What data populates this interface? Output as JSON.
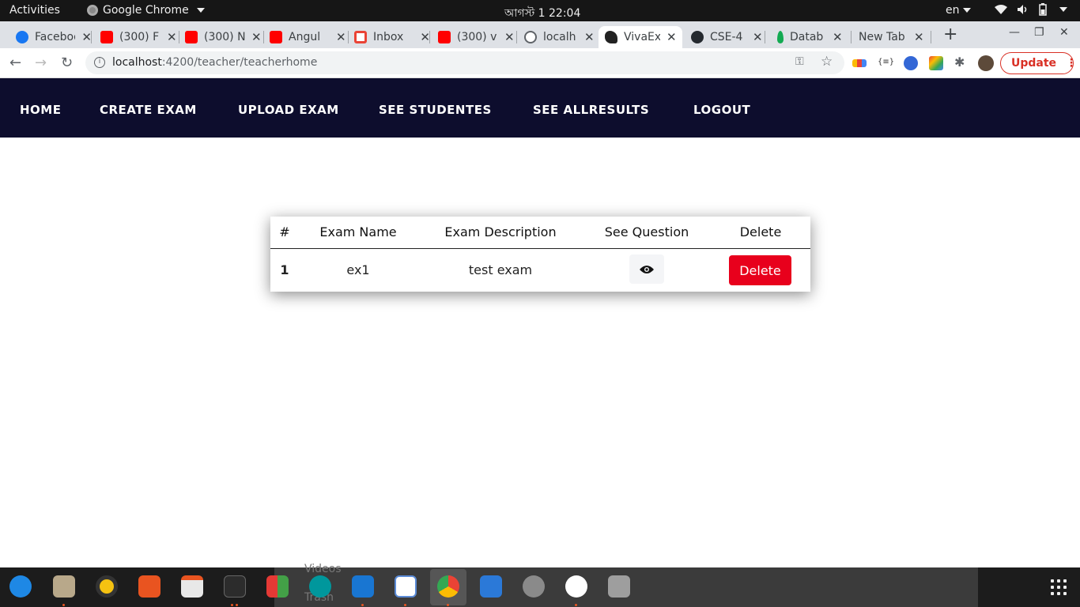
{
  "system_bar": {
    "activities": "Activities",
    "app_name": "Google Chrome",
    "clock": "আগস্ট 1  22:04",
    "language": "en"
  },
  "browser": {
    "tabs": [
      {
        "title": "Facebook",
        "icon": "facebook-icon"
      },
      {
        "title": "(300) F",
        "icon": "youtube-icon"
      },
      {
        "title": "(300) N",
        "icon": "youtube-icon"
      },
      {
        "title": "Angul",
        "icon": "youtube-icon"
      },
      {
        "title": "Inbox",
        "icon": "gmail-icon"
      },
      {
        "title": "(300) v",
        "icon": "youtube-icon"
      },
      {
        "title": "localh",
        "icon": "globe-icon"
      },
      {
        "title": "VivaEx",
        "icon": "vivaexam-icon",
        "active": true
      },
      {
        "title": "CSE-4",
        "icon": "github-icon"
      },
      {
        "title": "Datab",
        "icon": "mongodb-icon"
      },
      {
        "title": "New Tab",
        "icon": ""
      }
    ],
    "url_host": "localhost",
    "url_path": ":4200/teacher/teacherhome",
    "update_label": "Update"
  },
  "navbar": {
    "home": "HOME",
    "create_exam": "CREATE EXAM",
    "upload_exam": "UPLOAD EXAM",
    "see_students": "SEE STUDENTES",
    "see_allresults": "SEE ALLRESULTS",
    "logout": "LOGOUT"
  },
  "exam_table": {
    "headers": {
      "number": "#",
      "exam_name": "Exam Name",
      "exam_description": "Exam Description",
      "see_question": "See Question",
      "delete": "Delete"
    },
    "rows": [
      {
        "number": "1",
        "exam_name": "ex1",
        "exam_description": "test exam",
        "delete_label": "Delete"
      }
    ]
  },
  "dock": {
    "ghost_labels": [
      "Videos",
      "Trash"
    ]
  },
  "colors": {
    "navbar_bg": "#0d0d2d",
    "delete_button": "#e8001c",
    "update_button": "#d93025"
  }
}
